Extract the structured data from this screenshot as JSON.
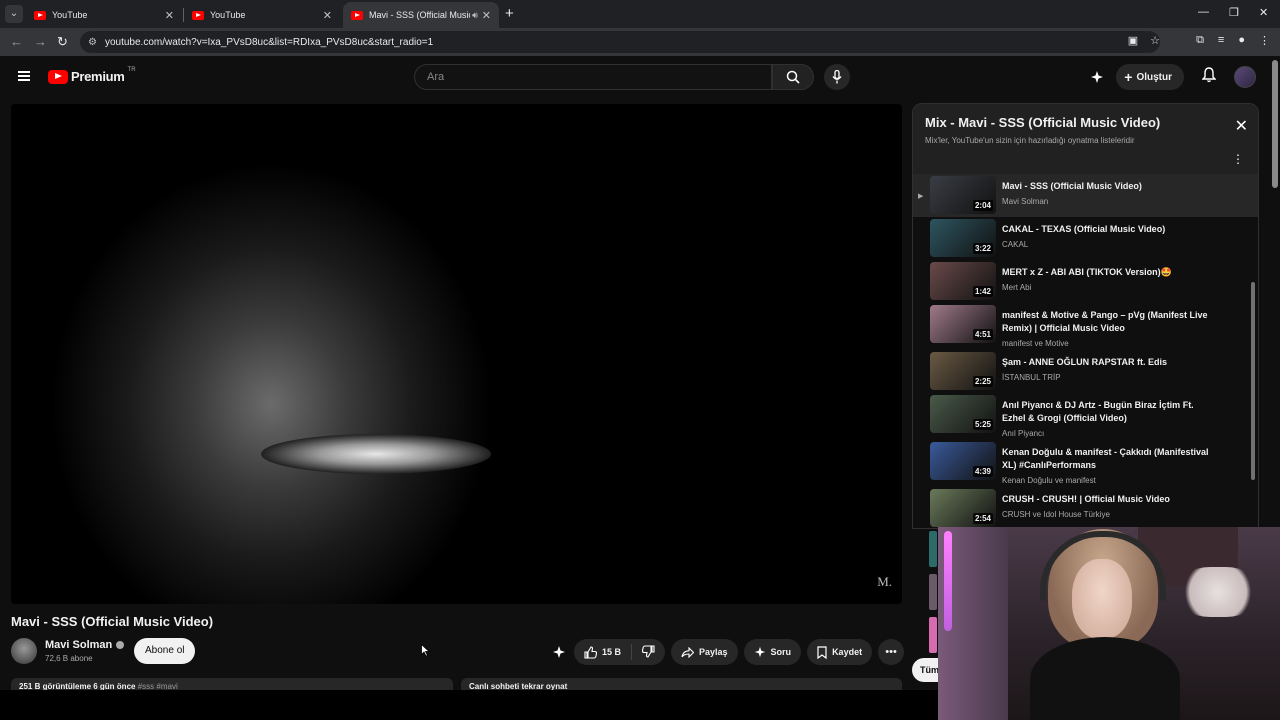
{
  "browser": {
    "tabs": [
      {
        "title": "YouTube",
        "active": false
      },
      {
        "title": "YouTube",
        "active": false
      },
      {
        "title": "Mavi - SSS (Official Music V",
        "active": true
      }
    ],
    "url": "youtube.com/watch?v=Ixa_PVsD8uc&list=RDIxa_PVsD8uc&start_radio=1"
  },
  "header": {
    "logo_text": "Premium",
    "country_code": "TR",
    "search_placeholder": "Ara",
    "create_label": "Oluştur"
  },
  "video": {
    "watermark": "M.",
    "title": "Mavi - SSS (Official Music Video)",
    "channel_name": "Mavi Solman",
    "subscribers": "72,6 B abone",
    "subscribe_label": "Abone ol",
    "like_count": "15 B",
    "share_label": "Paylaş",
    "ask_label": "Soru",
    "save_label": "Kaydet",
    "description_preview": "251 B görüntüleme  6 gün önce",
    "description_tags": "#sss #mavi",
    "chat_replay_label": "Canlı sohbeti tekrar oynat"
  },
  "playlist": {
    "title": "Mix - Mavi - SSS (Official Music Video)",
    "subtitle": "Mix'ler, YouTube'un sizin için hazırladığı oynatma listeleridir",
    "current_marker": "▶",
    "items": [
      {
        "title": "Mavi - SSS (Official Music Video)",
        "channel": "Mavi Solman",
        "duration": "2:04",
        "current": true,
        "color": "#3a3d44"
      },
      {
        "title": "CAKAL - TEXAS (Official Music Video)",
        "channel": "CAKAL",
        "duration": "3:22",
        "current": false,
        "color": "#2d5560"
      },
      {
        "title": "MERT x Z - ABI ABI (TIKTOK Version)🤩",
        "channel": "Mert Abi",
        "duration": "1:42",
        "current": false,
        "color": "#6a4a4a"
      },
      {
        "title": "manifest & Motive & Pango – pVg (Manifest Live Remix) | Official Music Video",
        "channel": "manifest ve Motive",
        "duration": "4:51",
        "current": false,
        "color": "#a07a8a"
      },
      {
        "title": "Şam - ANNE OĞLUN RAPSTAR ft. Edis",
        "channel": "İSTANBUL TRİP",
        "duration": "2:25",
        "current": false,
        "color": "#6a5a44"
      },
      {
        "title": "Anıl Piyancı & DJ Artz - Bugün Biraz İçtim Ft. Ezhel & Grogi (Official Video)",
        "channel": "Anıl Piyancı",
        "duration": "5:25",
        "current": false,
        "color": "#4a5a4a"
      },
      {
        "title": "Kenan Doğulu & manifest - Çakkıdı (Manifestival XL) #CanlıPerformans",
        "channel": "Kenan Doğulu ve manifest",
        "duration": "4:39",
        "current": false,
        "color": "#3a5a9a"
      },
      {
        "title": "CRUSH - CRUSH! | Official Music Video",
        "channel": "CRUSH ve Idol House Türkiye",
        "duration": "2:54",
        "current": false,
        "color": "#6a7a5a"
      }
    ]
  },
  "tum_label": "Tüm"
}
